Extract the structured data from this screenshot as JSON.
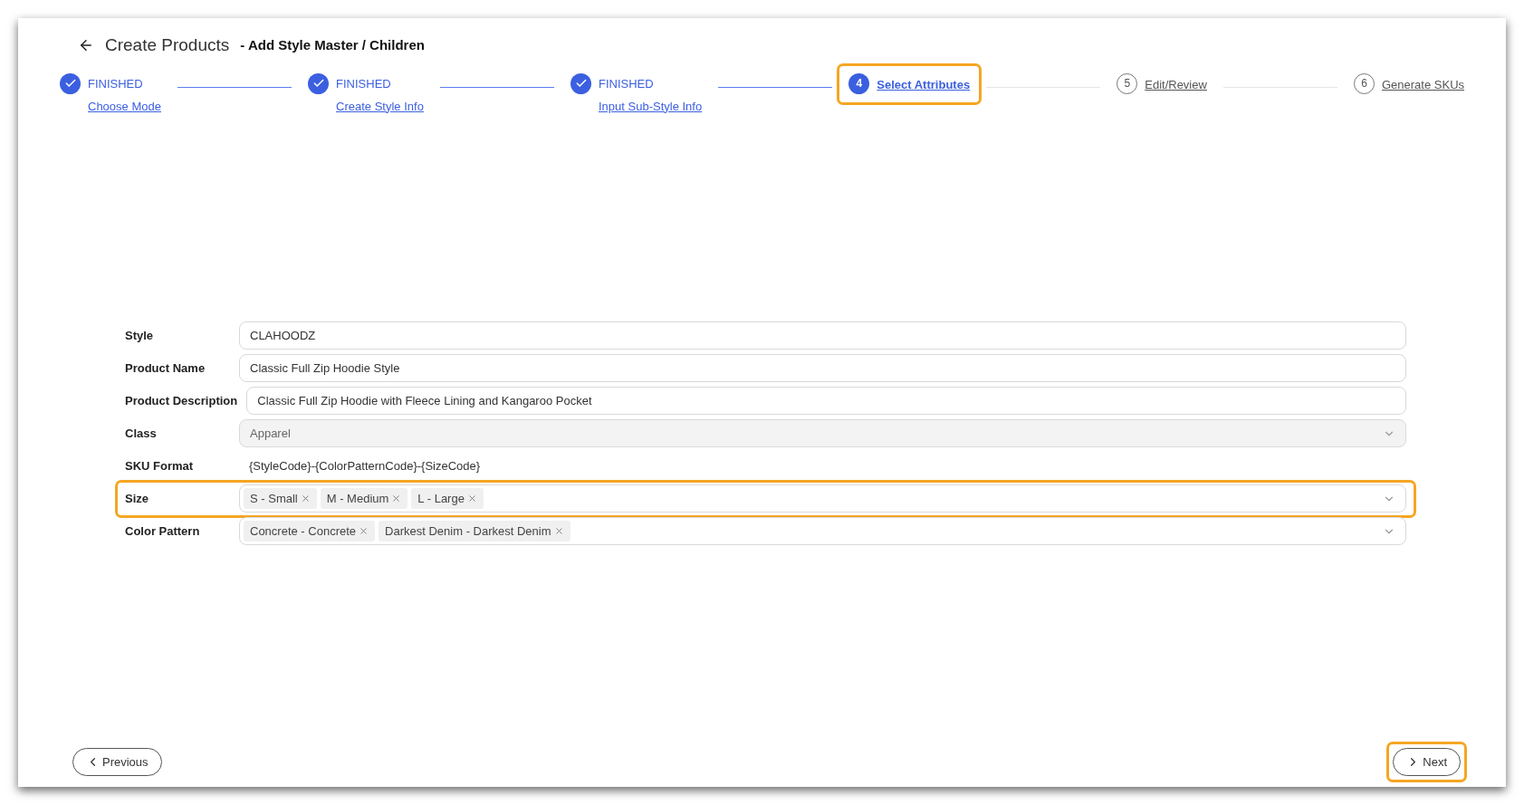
{
  "header": {
    "title": "Create Products",
    "subtitle": "- Add Style Master / Children"
  },
  "steps": [
    {
      "done": true,
      "selected": false,
      "state_label": "FINISHED",
      "label": "Choose Mode",
      "highlighted": false
    },
    {
      "done": true,
      "selected": false,
      "state_label": "FINISHED",
      "label": "Create Style Info",
      "highlighted": false
    },
    {
      "done": true,
      "selected": false,
      "state_label": "FINISHED",
      "label": "Input Sub-Style Info",
      "highlighted": false
    },
    {
      "done": false,
      "selected": true,
      "number": "4",
      "label": "Select Attributes",
      "highlighted": true
    },
    {
      "done": false,
      "selected": false,
      "number": "5",
      "label": "Edit/Review",
      "highlighted": false
    },
    {
      "done": false,
      "selected": false,
      "number": "6",
      "label": "Generate SKUs",
      "highlighted": false
    }
  ],
  "fields": [
    {
      "kind": "text",
      "label": "Style",
      "value": "CLAHOODZ",
      "highlighted": false
    },
    {
      "kind": "text",
      "label": "Product Name",
      "value": "Classic Full Zip Hoodie Style",
      "highlighted": false
    },
    {
      "kind": "text",
      "label": "Product Description",
      "value": "Classic Full Zip Hoodie with Fleece Lining and Kangaroo Pocket",
      "highlighted": false
    },
    {
      "kind": "select",
      "label": "Class",
      "value": "Apparel",
      "disabled": true,
      "highlighted": false
    },
    {
      "kind": "plain",
      "label": "SKU Format",
      "value": "{StyleCode}-{ColorPatternCode}-{SizeCode}",
      "highlighted": false
    },
    {
      "kind": "multi",
      "label": "Size",
      "tags": [
        "S - Small",
        "M - Medium",
        "L - Large"
      ],
      "highlighted": true
    },
    {
      "kind": "multi",
      "label": "Color Pattern",
      "tags": [
        "Concrete - Concrete",
        "Darkest Denim - Darkest Denim"
      ],
      "highlighted": false
    }
  ],
  "footer": {
    "previous": {
      "label": "Previous",
      "highlighted": false
    },
    "next": {
      "label": "Next",
      "highlighted": true
    }
  }
}
